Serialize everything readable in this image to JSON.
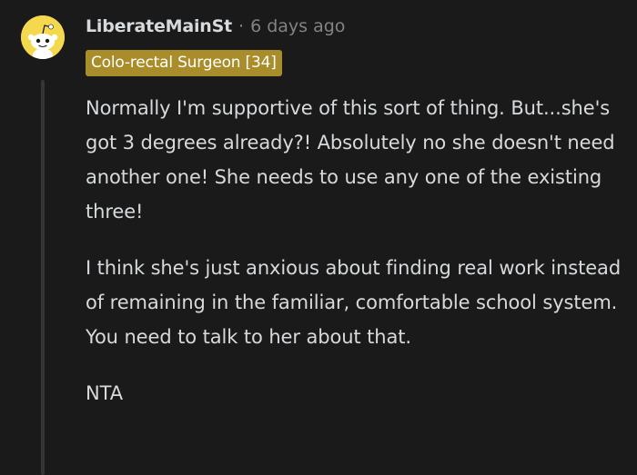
{
  "comment": {
    "avatar_icon": "reddit-snoo-icon",
    "avatar_color": "#f4d94f",
    "username": "LiberateMainSt",
    "separator": "·",
    "timestamp": "6 days ago",
    "flair": "Colo-rectal Surgeon [34]",
    "flair_color": "#aa8d2b",
    "paragraphs": [
      "Normally I'm supportive of this sort of thing. But...she's got 3 degrees already?! Absolutely no she doesn't need another one! She needs to use any one of the existing three!",
      "I think she's just anxious about finding real work instead of remaining in the familiar, comfortable school system. You need to talk to her about that.",
      "NTA"
    ]
  }
}
